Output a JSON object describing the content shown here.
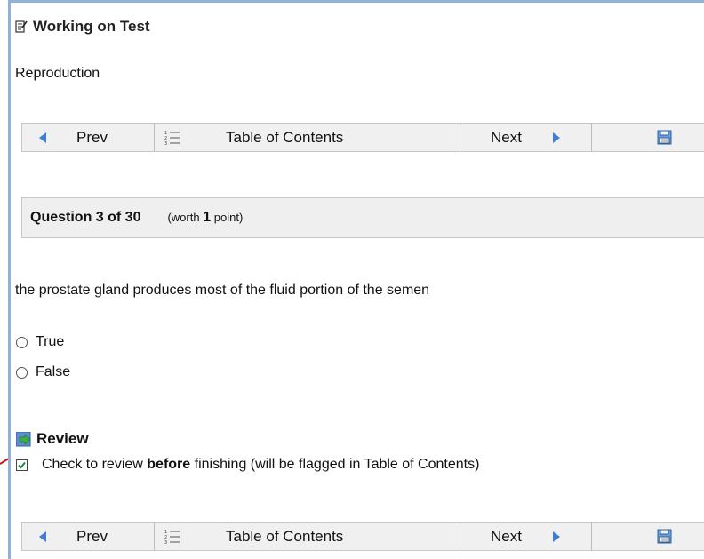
{
  "header": {
    "title": "Working on Test",
    "subject": "Reproduction"
  },
  "nav": {
    "prev_label": "Prev",
    "toc_label": "Table of Contents",
    "next_label": "Next"
  },
  "question": {
    "number_label": "Question 3 of 30",
    "worth_prefix": "(worth",
    "worth_points": "1",
    "worth_suffix": "point)",
    "text": "the prostate gland produces most of the fluid portion of the semen",
    "options": [
      "True",
      "False"
    ]
  },
  "review": {
    "heading": "Review",
    "checkbox_checked": true,
    "text_before": "Check to review",
    "text_bold": "before",
    "text_after": "finishing (will be flagged in Table of Contents)"
  },
  "colors": {
    "frame_border": "#8fb2d6",
    "nav_arrow": "#3d7fd8",
    "checkbox_check": "#1f8a3c",
    "annotation_line": "#d01010"
  }
}
